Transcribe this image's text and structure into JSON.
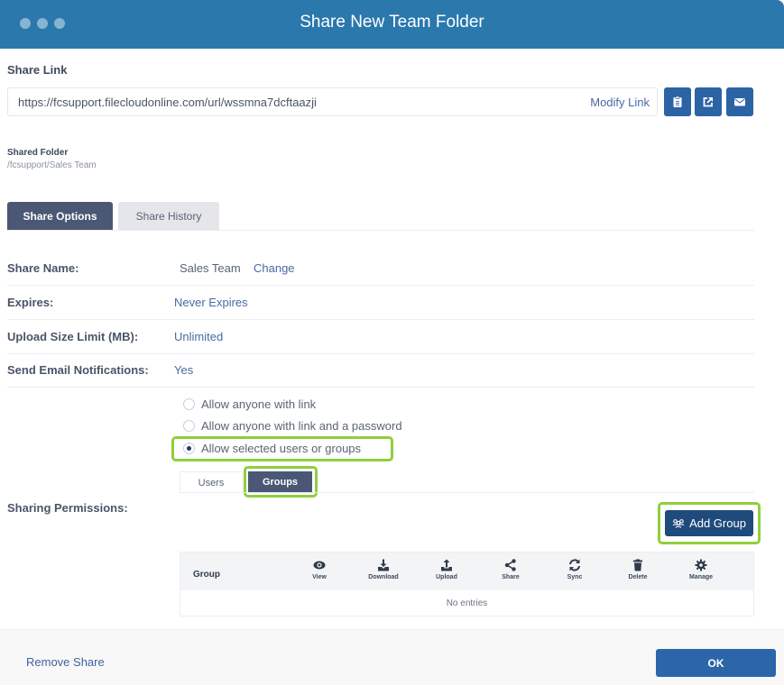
{
  "window": {
    "title": "Share New Team Folder"
  },
  "share_link": {
    "label": "Share Link",
    "url": "https://fcsupport.filecloudonline.com/url/wssmna7dcftaazji",
    "modify_label": "Modify Link",
    "actions": [
      {
        "icon": "clipboard-icon",
        "label": "Copy link"
      },
      {
        "icon": "external-link-icon",
        "label": "Open link"
      },
      {
        "icon": "envelope-icon",
        "label": "Email link"
      }
    ]
  },
  "shared_folder": {
    "label": "Shared Folder",
    "path": "/fcsupport/Sales Team"
  },
  "tabs": [
    {
      "label": "Share Options",
      "active": true
    },
    {
      "label": "Share History",
      "active": false
    }
  ],
  "options": {
    "share_name": {
      "label": "Share Name:",
      "value": "Sales Team",
      "action": "Change"
    },
    "expires": {
      "label": "Expires:",
      "value": "Never Expires"
    },
    "upload_limit": {
      "label": "Upload Size Limit (MB):",
      "value": "Unlimited"
    },
    "email_notifications": {
      "label": "Send Email Notifications:",
      "value": "Yes"
    }
  },
  "permissions": {
    "label": "Sharing Permissions:",
    "access_options": [
      {
        "label": "Allow anyone with link",
        "selected": false
      },
      {
        "label": "Allow anyone with link and a password",
        "selected": false
      },
      {
        "label": "Allow selected users or groups",
        "selected": true
      }
    ],
    "subtabs": [
      {
        "label": "Users",
        "active": false
      },
      {
        "label": "Groups",
        "active": true
      }
    ],
    "add_group_label": "Add Group",
    "table": {
      "first_column": "Group",
      "columns": [
        {
          "label": "View",
          "icon": "eye-icon"
        },
        {
          "label": "Download",
          "icon": "download-icon"
        },
        {
          "label": "Upload",
          "icon": "upload-icon"
        },
        {
          "label": "Share",
          "icon": "share-icon"
        },
        {
          "label": "Sync",
          "icon": "sync-icon"
        },
        {
          "label": "Delete",
          "icon": "trash-icon"
        },
        {
          "label": "Manage",
          "icon": "gear-icon"
        }
      ],
      "empty_text": "No entries"
    }
  },
  "footer": {
    "remove_label": "Remove Share",
    "ok_label": "OK"
  },
  "colors": {
    "header": "#2a78ac",
    "primary": "#2b66a8",
    "highlight": "#8fcf3c",
    "tab_active": "#4a5875"
  }
}
